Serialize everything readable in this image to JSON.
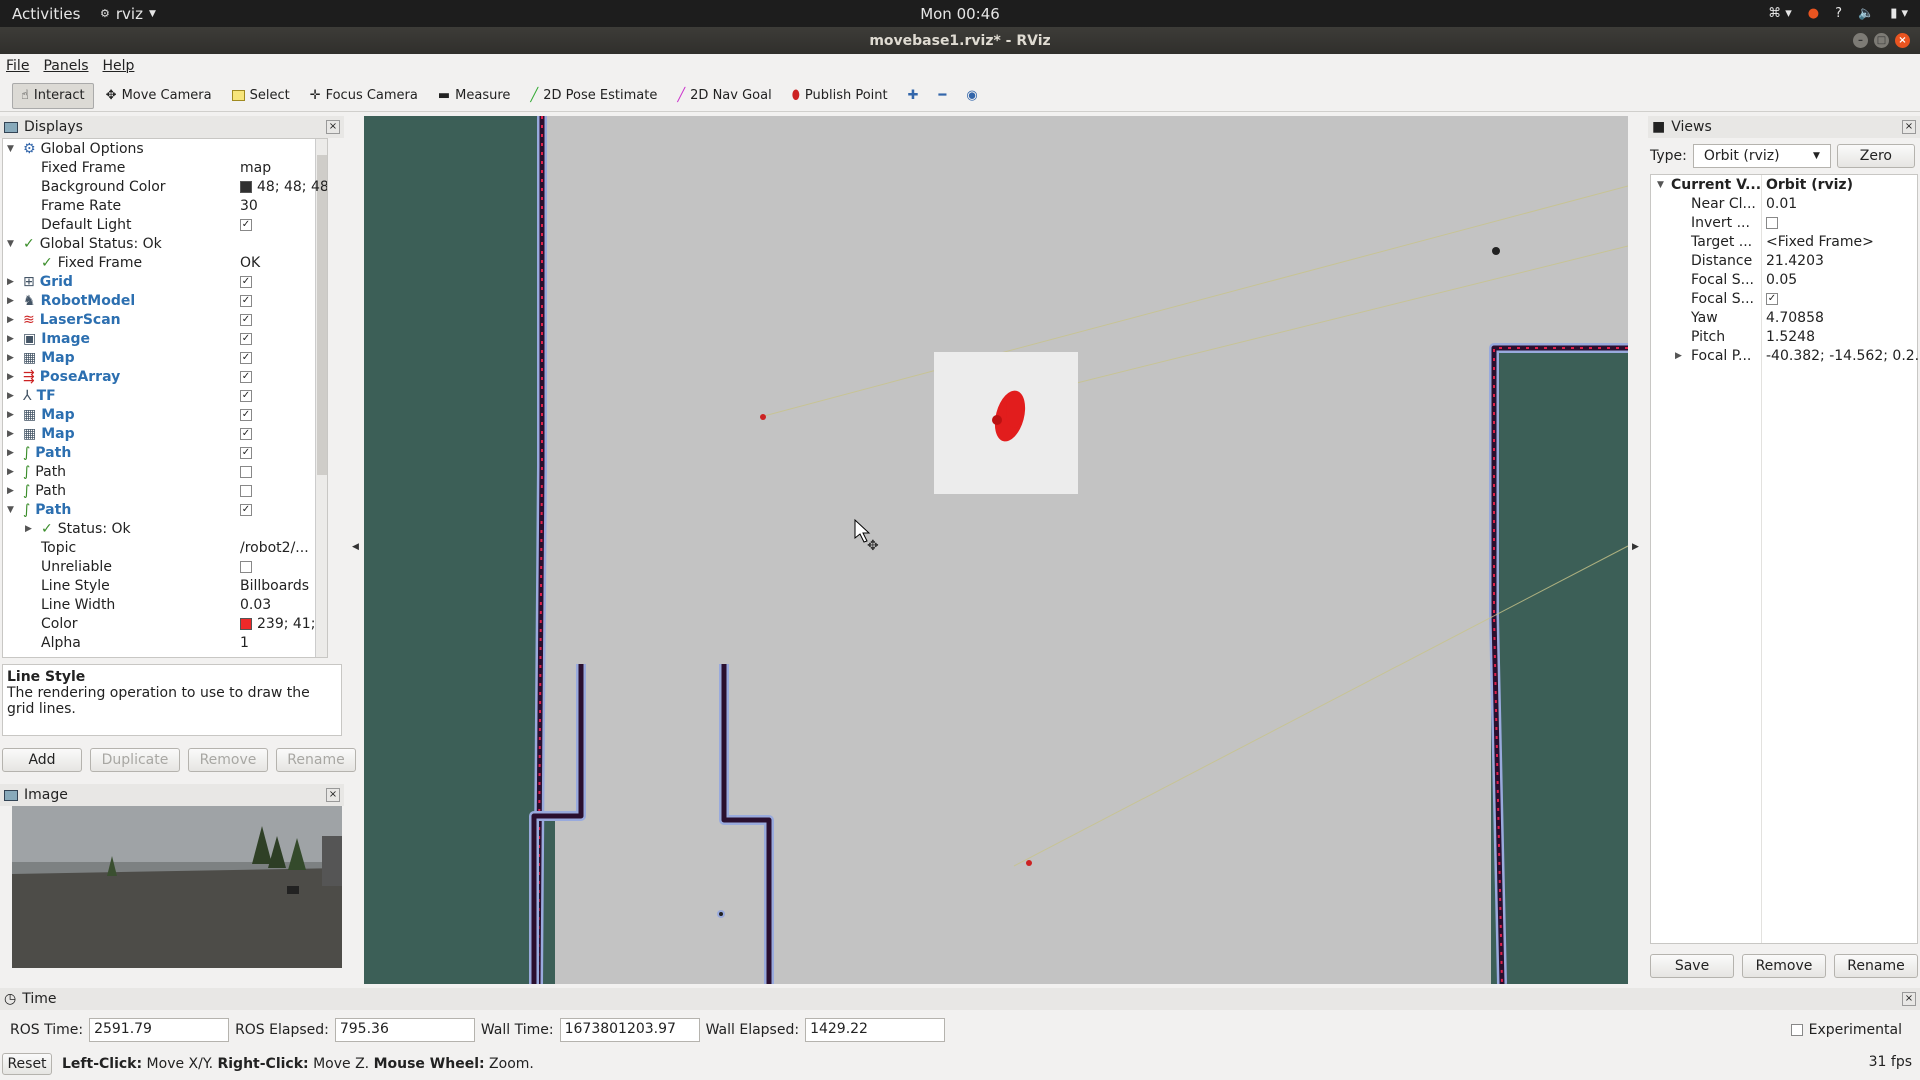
{
  "topbar": {
    "activities": "Activities",
    "app": "rviz",
    "clock": "Mon 00:46"
  },
  "window": {
    "title": "movebase1.rviz* - RViz"
  },
  "menu": [
    "File",
    "Panels",
    "Help"
  ],
  "toolbar": [
    {
      "label": "Interact",
      "icon": "hand-icon",
      "active": true
    },
    {
      "label": "Move Camera",
      "icon": "move-icon"
    },
    {
      "label": "Select",
      "icon": "select-icon"
    },
    {
      "label": "Focus Camera",
      "icon": "focus-icon"
    },
    {
      "label": "Measure",
      "icon": "ruler-icon"
    },
    {
      "label": "2D Pose Estimate",
      "icon": "green-arrow-icon"
    },
    {
      "label": "2D Nav Goal",
      "icon": "pink-arrow-icon"
    },
    {
      "label": "Publish Point",
      "icon": "pin-icon"
    }
  ],
  "displays": {
    "title": "Displays",
    "rows": [
      {
        "name": "Global Options",
        "level": 0,
        "expanded": true
      },
      {
        "name": "Fixed Frame",
        "level": 1,
        "value": "map"
      },
      {
        "name": "Background Color",
        "level": 1,
        "value": "48; 48; 48",
        "swatch": "#303030"
      },
      {
        "name": "Frame Rate",
        "level": 1,
        "value": "30"
      },
      {
        "name": "Default Light",
        "level": 1,
        "check": true
      },
      {
        "name": "Global Status: Ok",
        "level": 0,
        "expanded": true,
        "ok": true
      },
      {
        "name": "Fixed Frame",
        "level": 1,
        "value": "OK",
        "ok": true
      },
      {
        "name": "Grid",
        "level": 0,
        "blue": true,
        "check": true
      },
      {
        "name": "RobotModel",
        "level": 0,
        "blue": true,
        "check": true
      },
      {
        "name": "LaserScan",
        "level": 0,
        "blue": true,
        "check": true
      },
      {
        "name": "Image",
        "level": 0,
        "blue": true,
        "check": true
      },
      {
        "name": "Map",
        "level": 0,
        "blue": true,
        "check": true
      },
      {
        "name": "PoseArray",
        "level": 0,
        "blue": true,
        "check": true
      },
      {
        "name": "TF",
        "level": 0,
        "blue": true,
        "check": true
      },
      {
        "name": "Map",
        "level": 0,
        "blue": true,
        "check": true
      },
      {
        "name": "Map",
        "level": 0,
        "blue": true,
        "check": true
      },
      {
        "name": "Path",
        "level": 0,
        "blue": true,
        "check": true
      },
      {
        "name": "Path",
        "level": 0,
        "check": false
      },
      {
        "name": "Path",
        "level": 0,
        "check": false
      },
      {
        "name": "Path",
        "level": 0,
        "blue": true,
        "check": true,
        "expanded": true
      },
      {
        "name": "Status: Ok",
        "level": 1,
        "ok": true,
        "collapsed": true
      },
      {
        "name": "Topic",
        "level": 1,
        "value": "/robot2/..."
      },
      {
        "name": "Unreliable",
        "level": 1,
        "check": false
      },
      {
        "name": "Line Style",
        "level": 1,
        "value": "Billboards"
      },
      {
        "name": "Line Width",
        "level": 1,
        "value": "0.03"
      },
      {
        "name": "Color",
        "level": 1,
        "value": "239; 41;",
        "swatch": "#ef2929"
      },
      {
        "name": "Alpha",
        "level": 1,
        "value": "1"
      }
    ],
    "desc_title": "Line Style",
    "desc_text": "The rendering operation to use to draw the grid lines.",
    "buttons": [
      "Add",
      "Duplicate",
      "Remove",
      "Rename"
    ]
  },
  "image_panel": {
    "title": "Image"
  },
  "views": {
    "title": "Views",
    "type_label": "Type:",
    "type_value": "Orbit (rviz)",
    "zero": "Zero",
    "rows": [
      {
        "name": "Current V...",
        "value": "Orbit (rviz)",
        "bold": true
      },
      {
        "name": "Near Cl...",
        "value": "0.01"
      },
      {
        "name": "Invert ...",
        "check": false
      },
      {
        "name": "Target ...",
        "value": "<Fixed Frame>"
      },
      {
        "name": "Distance",
        "value": "21.4203"
      },
      {
        "name": "Focal S...",
        "value": "0.05"
      },
      {
        "name": "Focal S...",
        "check": true
      },
      {
        "name": "Yaw",
        "value": "4.70858"
      },
      {
        "name": "Pitch",
        "value": "1.5248"
      },
      {
        "name": "Focal P...",
        "value": "-40.382; -14.562; 0.2...",
        "arrow": true
      }
    ],
    "buttons": [
      "Save",
      "Remove",
      "Rename"
    ]
  },
  "time": {
    "title": "Time",
    "ros_time_label": "ROS Time:",
    "ros_time": "2591.79",
    "ros_elapsed_label": "ROS Elapsed:",
    "ros_elapsed": "795.36",
    "wall_time_label": "Wall Time:",
    "wall_time": "1673801203.97",
    "wall_elapsed_label": "Wall Elapsed:",
    "wall_elapsed": "1429.22",
    "experimental": "Experimental"
  },
  "status": {
    "reset": "Reset",
    "k1": "Left-Click:",
    "v1": "Move X/Y.",
    "k2": "Right-Click:",
    "v2": "Move Z.",
    "k3": "Mouse Wheel:",
    "v3": "Zoom.",
    "fps": "31 fps"
  }
}
